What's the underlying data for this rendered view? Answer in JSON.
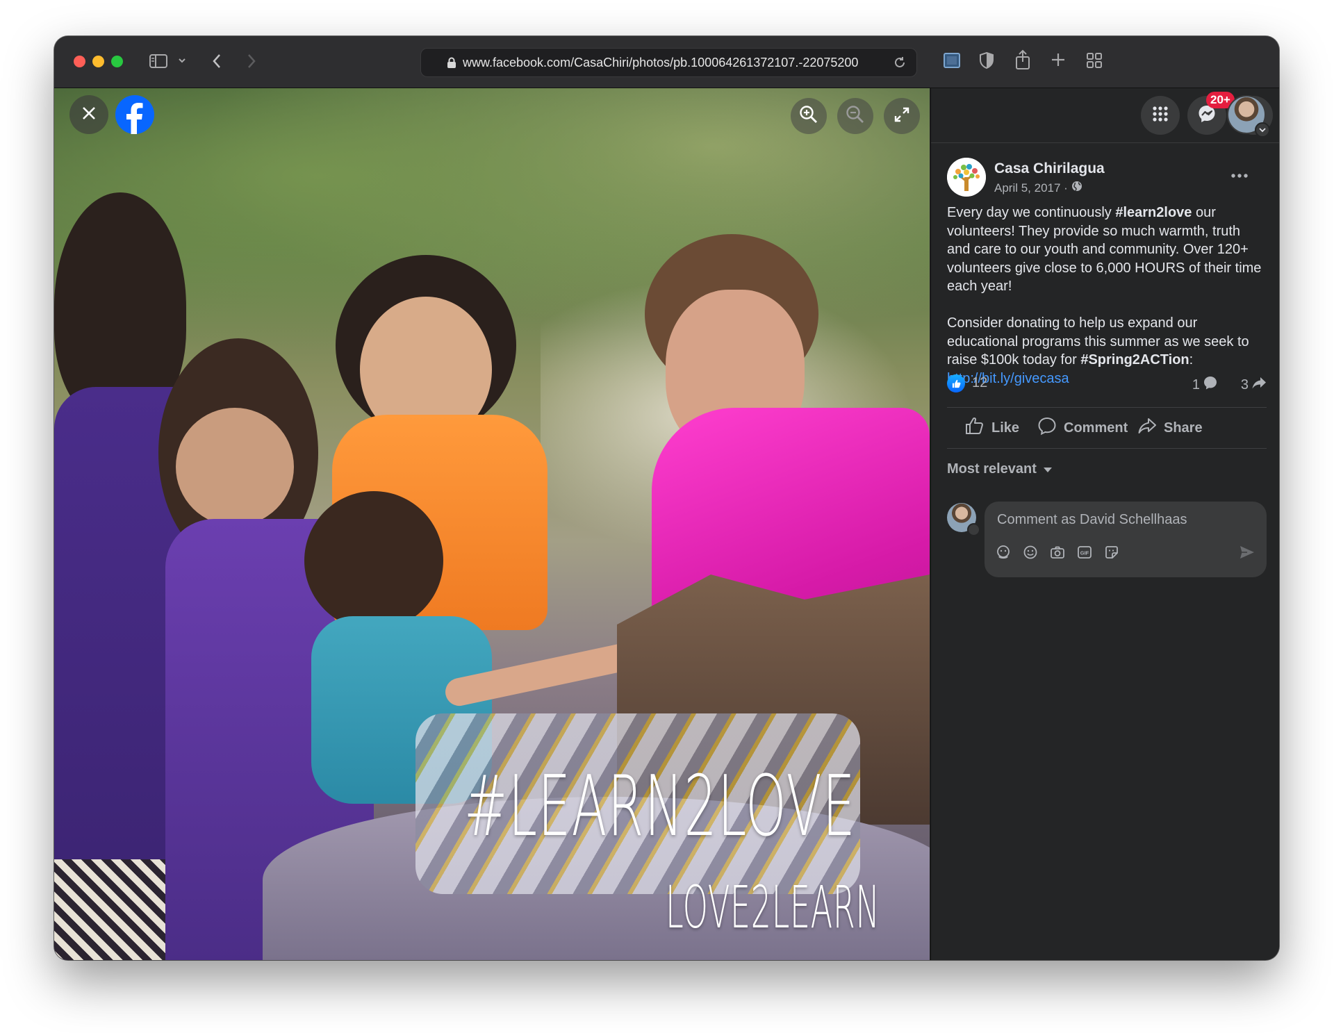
{
  "browser": {
    "url": "www.facebook.com/CasaChiri/photos/pb.100064261372107.-22075200"
  },
  "photo": {
    "overlay_line1": "#LEARN2LOVE",
    "overlay_line2": "LOVE2LEARN"
  },
  "nav": {
    "notification_badge": "20+"
  },
  "post": {
    "page_name": "Casa Chirilagua",
    "date": "April 5, 2017 ·",
    "text_p1_a": "Every day we continuously ",
    "text_p1_tag": "#learn2love",
    "text_p1_b": " our volunteers! They provide so much warmth, truth and care to our youth and community. Over 120+ volunteers give close to 6,000 HOURS of their time each year!",
    "text_p2_a": "Consider donating to help us expand our educational programs this summer as we seek to raise $100k today for ",
    "text_p2_tag": "#Spring2ACTion",
    "text_p2_b": ":",
    "link": "http://bit.ly/givecasa",
    "reaction_count": "12",
    "comment_count": "1",
    "share_count": "3"
  },
  "actions": {
    "like": "Like",
    "comment": "Comment",
    "share": "Share"
  },
  "comments": {
    "sort_label": "Most relevant",
    "input_placeholder": "Comment as David Schellhaas"
  },
  "icons": {
    "close": "close-icon",
    "facebook": "facebook-logo-icon",
    "zoom_in": "zoom-in-icon",
    "zoom_out": "zoom-out-icon",
    "fullscreen": "fullscreen-icon",
    "menu": "menu-grid-icon",
    "messenger": "messenger-icon",
    "notifications": "bell-icon"
  },
  "colors": {
    "accent_blue": "#0866ff",
    "link_blue": "#4599ff",
    "badge_red": "#e41e3f",
    "panel_bg": "#242526"
  }
}
